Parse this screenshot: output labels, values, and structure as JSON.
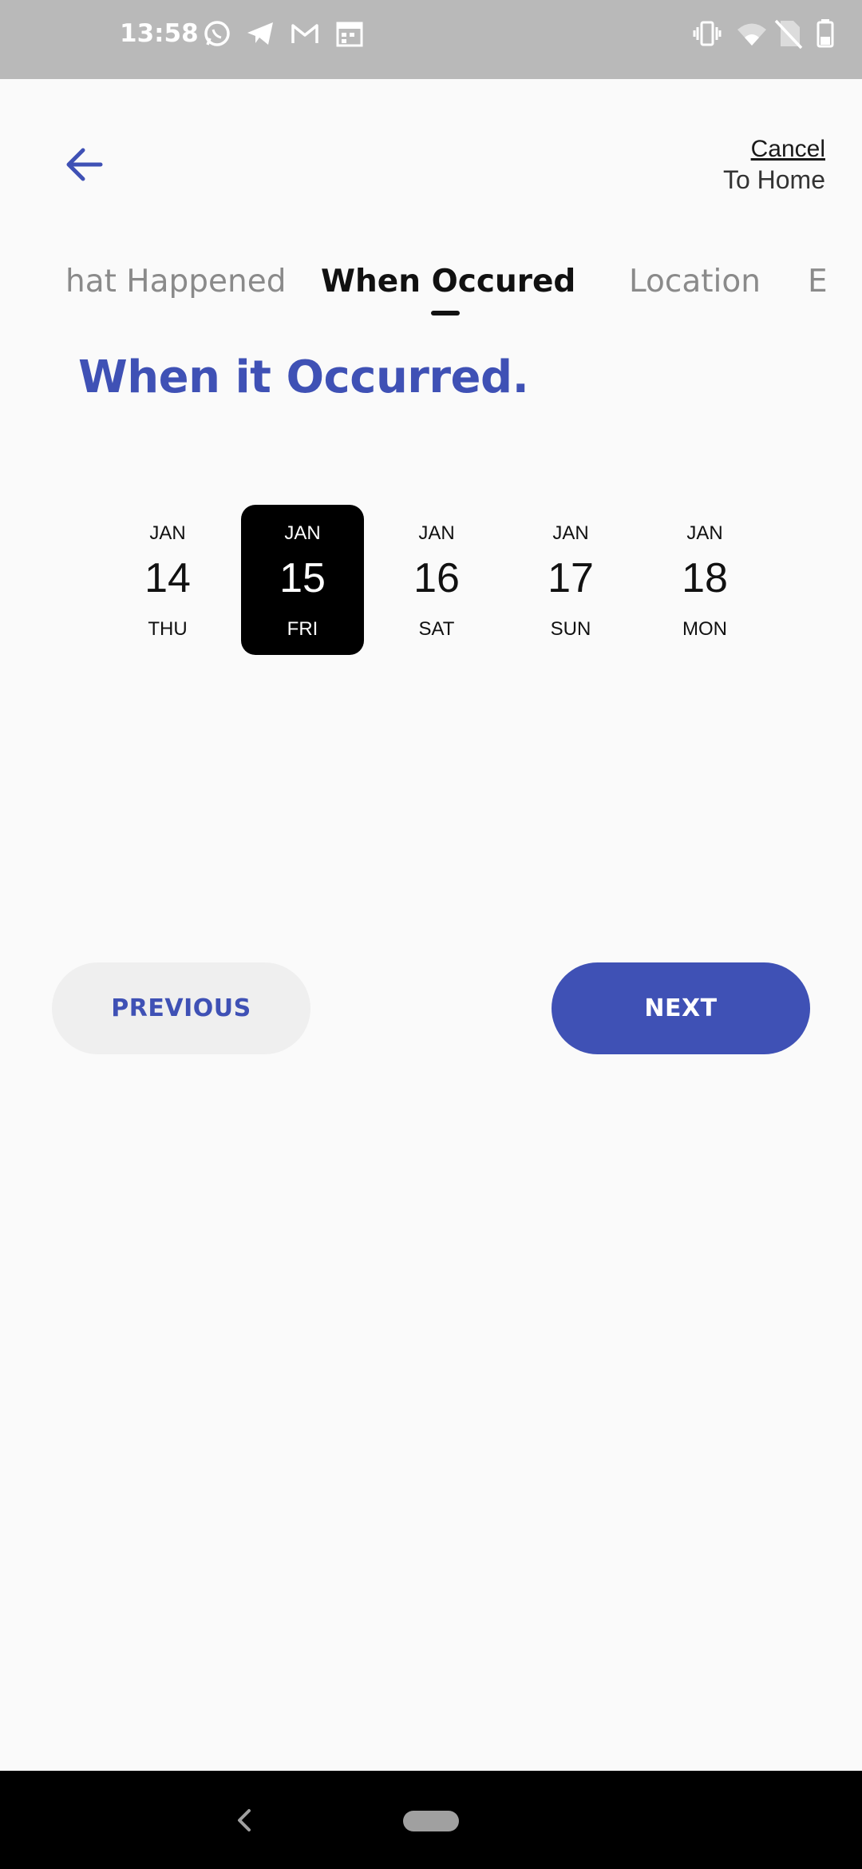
{
  "status_bar": {
    "time": "13:58",
    "left_icons": [
      "whatsapp-icon",
      "telegram-icon",
      "gmail-icon",
      "calendar-icon"
    ],
    "right_icons": [
      "vibrate-icon",
      "wifi-icon",
      "no-sim-icon",
      "battery-icon"
    ]
  },
  "header": {
    "cancel_label": "Cancel",
    "cancel_sub": "To Home"
  },
  "tabs": [
    {
      "label": "hat Happened",
      "active": false
    },
    {
      "label": "When Occured",
      "active": true
    },
    {
      "label": "Location",
      "active": false
    },
    {
      "label": "E",
      "active": false
    }
  ],
  "title": "When it Occurred.",
  "dates": [
    {
      "month": "JAN",
      "day": "14",
      "dow": "THU",
      "selected": false
    },
    {
      "month": "JAN",
      "day": "15",
      "dow": "FRI",
      "selected": true
    },
    {
      "month": "JAN",
      "day": "16",
      "dow": "SAT",
      "selected": false
    },
    {
      "month": "JAN",
      "day": "17",
      "dow": "SUN",
      "selected": false
    },
    {
      "month": "JAN",
      "day": "18",
      "dow": "MON",
      "selected": false
    }
  ],
  "buttons": {
    "previous": "PREVIOUS",
    "next": "NEXT"
  },
  "colors": {
    "accent": "#3f51b5",
    "status_bar": "#b9b9b9",
    "background": "#fafafa",
    "selected_date": "#000000"
  }
}
